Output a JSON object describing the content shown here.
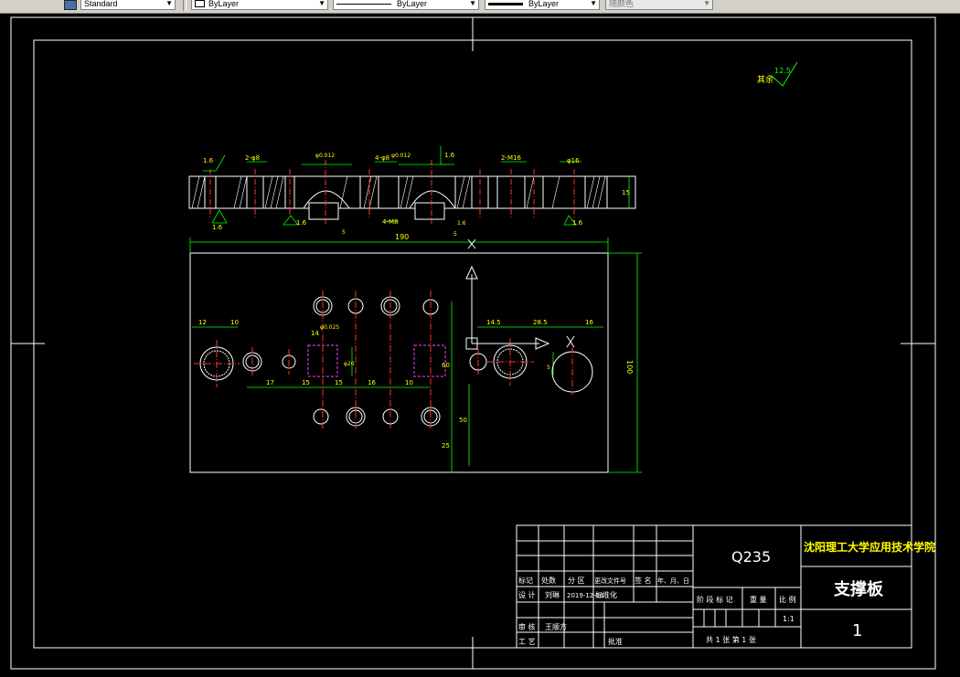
{
  "toolbar": {
    "text_style": "Standard",
    "layer_color": "ByLayer",
    "linetype": "ByLayer",
    "lineweight": "ByLayer",
    "plot_style": "随颜色"
  },
  "drawing": {
    "roughness_rest_label": "其余",
    "roughness_rest_value": "12.5",
    "section_annotations": [
      "1.6",
      "2-φ8",
      "φ0.012",
      "4-φ8",
      "φ0.012",
      "1.6",
      "2-M16",
      "φ16",
      "15",
      "1.6",
      "1.6",
      "5",
      "4-M8",
      "5",
      "1.6",
      "1.6"
    ],
    "dim_overall_width": "190",
    "dim_overall_height": "100",
    "plan_dims": [
      "12",
      "10",
      "14",
      "φ0.025",
      "14.5",
      "28.5",
      "16",
      "17",
      "15",
      "15",
      "16",
      "10",
      "φ20",
      "60",
      "5",
      "50",
      "25"
    ]
  },
  "title_block": {
    "material": "Q235",
    "school": "沈阳理工大学应用技术学院",
    "part_name": "支撑板",
    "drawing_no": "1",
    "col_mark": "标记",
    "col_count": "处数",
    "col_zone": "分 区",
    "col_change_doc": "更改文件号",
    "col_sign": "签 名",
    "col_date": "年、月、日",
    "design_label": "设 计",
    "designer": "刘琳",
    "design_date": "2019-12-23",
    "standardize_label": "标准化",
    "review_label": "审 核",
    "reviewer": "王顺方",
    "process_label": "工 艺",
    "approve_label": "批准",
    "stage_label": "阶 段 标 记",
    "weight_label": "重 量",
    "scale_label": "比 例",
    "scale_value": "1:1",
    "sheets_text": "共 1  张   第  1 张"
  }
}
